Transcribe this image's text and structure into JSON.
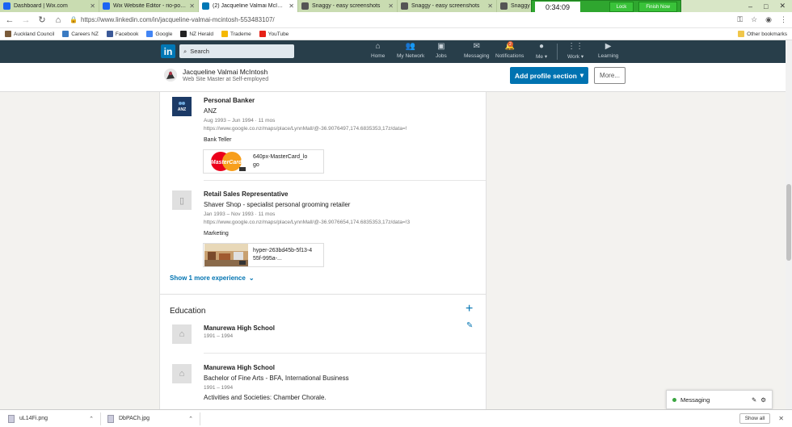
{
  "tabs": [
    {
      "title": "Dashboard | Wix.com",
      "fav_color": "#1c64f2",
      "active": false
    },
    {
      "title": "Wix Website Editor - rio-pousada",
      "fav_color": "#1c64f2",
      "active": false
    },
    {
      "title": "(2) Jacqueline Valmai McIntosh |",
      "fav_color": "#0077b5",
      "active": true
    },
    {
      "title": "Snaggy - easy screenshots",
      "fav_color": "#555555",
      "active": false
    },
    {
      "title": "Snaggy - easy screenshots",
      "fav_color": "#555555",
      "active": false
    },
    {
      "title": "Snaggy - e",
      "fav_color": "#555555",
      "active": false
    }
  ],
  "timer": {
    "time": "0:34:09",
    "lock": "Lock",
    "finish": "Finish Now"
  },
  "address": {
    "url": "https://www.linkedin.com/in/jacqueline-valmai-mcintosh-553483107/"
  },
  "bookmarks": [
    {
      "label": "Auckland Council",
      "color": "#7a5b3a"
    },
    {
      "label": "Careers NZ",
      "color": "#3a7ac2"
    },
    {
      "label": "Facebook",
      "color": "#3b5998"
    },
    {
      "label": "Google",
      "color": "#4285f4"
    },
    {
      "label": "NZ Herald",
      "color": "#222222"
    },
    {
      "label": "Trademe",
      "color": "#f5b800"
    },
    {
      "label": "YouTube",
      "color": "#e62117"
    }
  ],
  "other_bookmarks": "Other bookmarks",
  "linkedin": {
    "logo": "in",
    "search_placeholder": "Search",
    "nav": [
      {
        "label": "Home",
        "icon": "home-icon",
        "glyph": "⌂"
      },
      {
        "label": "My Network",
        "icon": "network-icon",
        "glyph": "👥"
      },
      {
        "label": "Jobs",
        "icon": "jobs-icon",
        "glyph": "▣"
      },
      {
        "label": "Messaging",
        "icon": "messaging-icon",
        "glyph": "✉"
      },
      {
        "label": "Notifications",
        "icon": "bell-icon",
        "glyph": "🔔"
      },
      {
        "label": "Me ▾",
        "icon": "me-avatar-icon",
        "glyph": "●"
      },
      {
        "label": "Work ▾",
        "icon": "grid-icon",
        "glyph": "⋮⋮"
      },
      {
        "label": "Learning",
        "icon": "learning-icon",
        "glyph": "▶"
      }
    ],
    "notif_count": "2"
  },
  "profile": {
    "name": "Jacqueline Valmai McIntosh",
    "headline": "Web Site Master at Self-employed",
    "add_section": "Add profile section",
    "more": "More..."
  },
  "experience": [
    {
      "title": "Personal Banker",
      "company": "ANZ",
      "dates": "Aug 1993 – Jun 1994 · 11 mos",
      "url": "https://www.google.co.nz/maps/place/LynnMall/@-36.9076497,174.6835353,17z/data=!",
      "desc": "Bank Teller",
      "media_title": "640px-MasterCard_logo",
      "logo_text": "ANZ"
    },
    {
      "title": "Retail Sales Representative",
      "company": "Shaver Shop - specialist personal grooming retailer",
      "dates": "Jan 1993 – Nov 1993 · 11 mos",
      "url": "https://www.google.co.nz/maps/place/LynnMall/@-36.9076654,174.6835353,17z/data=!3",
      "desc": "Marketing",
      "media_title": "hyper-263bd45b-5f13-455f-995a-..."
    }
  ],
  "show_more": "Show 1 more experience",
  "education": {
    "heading": "Education",
    "items": [
      {
        "school": "Manurewa High School",
        "degree": "",
        "dates": "1991 – 1994",
        "activities": ""
      },
      {
        "school": "Manurewa High School",
        "degree": "Bachelor of Fine Arts - BFA, International Business",
        "dates": "1991 – 1994",
        "activities": "Activities and Societies: Chamber Chorale."
      }
    ]
  },
  "messaging": {
    "label": "Messaging"
  },
  "downloads": [
    {
      "file": "uL14Fi.png"
    },
    {
      "file": "DbPACh.jpg"
    }
  ],
  "show_all": "Show all"
}
